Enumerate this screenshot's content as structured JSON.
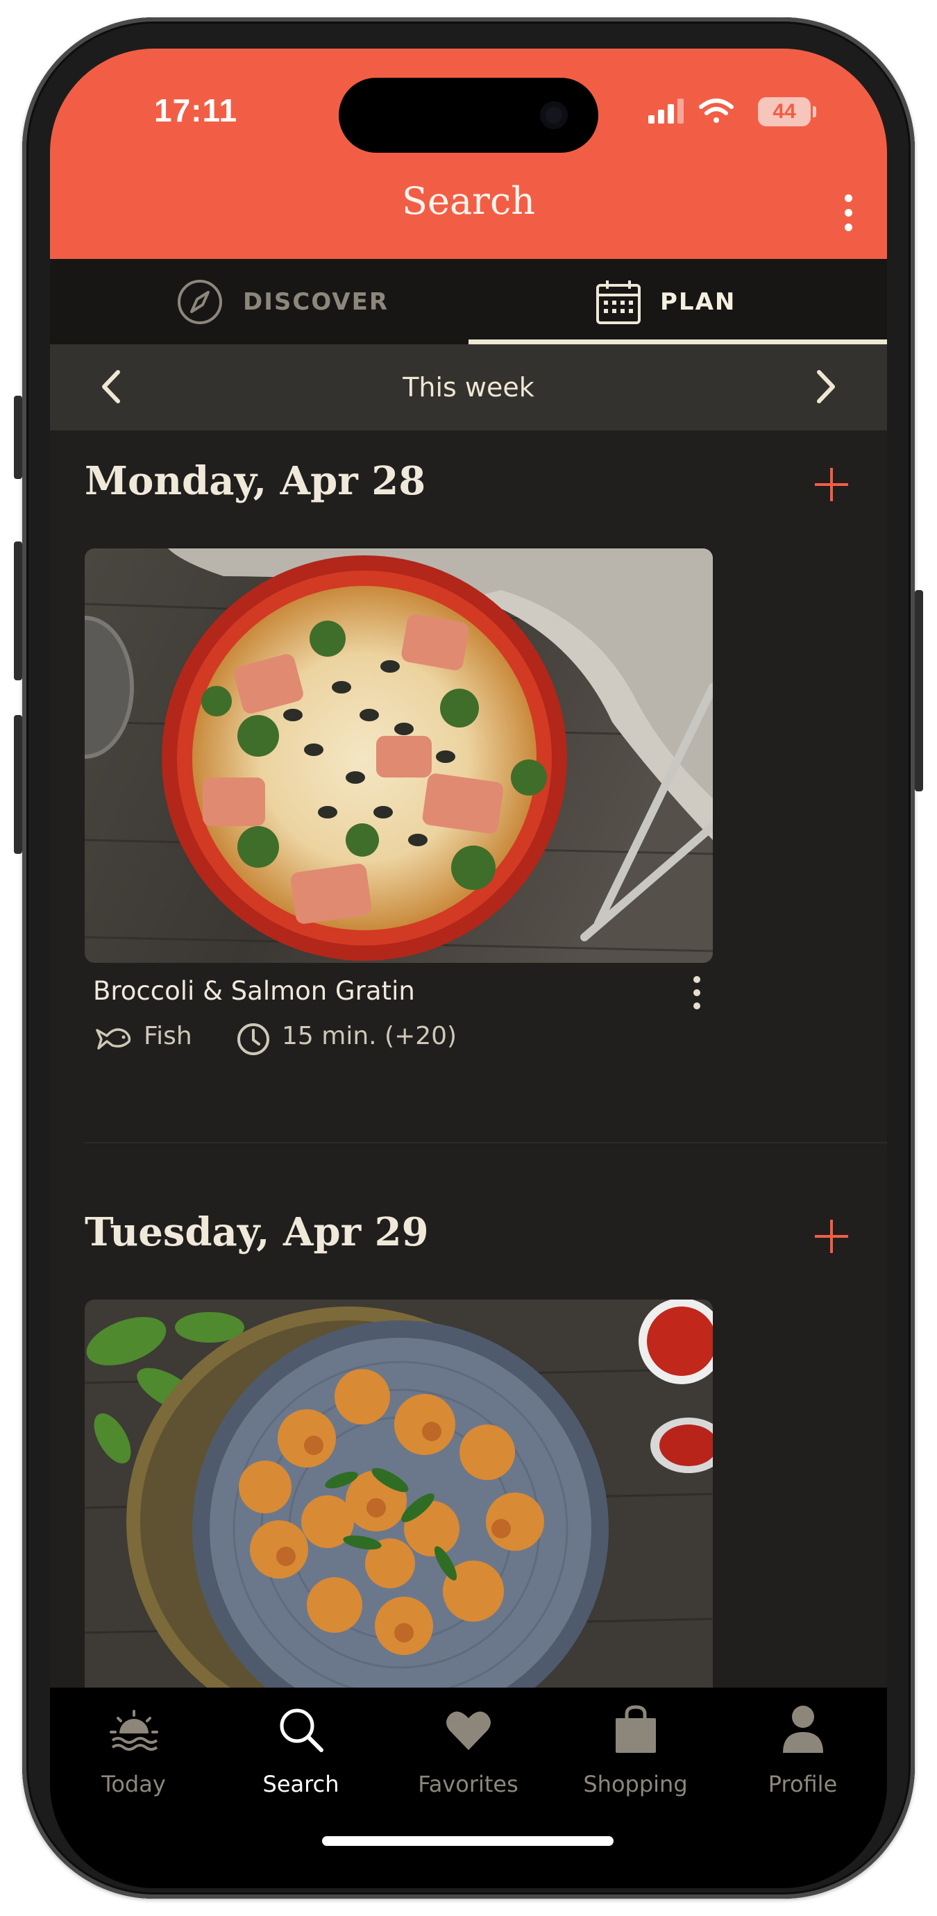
{
  "status_bar": {
    "time": "17:11",
    "battery": "44"
  },
  "header": {
    "title": "Search",
    "accent_color": "#f25e45"
  },
  "tabs": [
    {
      "label": "DISCOVER",
      "icon": "compass-icon",
      "selected": false
    },
    {
      "label": "PLAN",
      "icon": "calendar-icon",
      "selected": true
    }
  ],
  "week_nav": {
    "label": "This week"
  },
  "days": [
    {
      "title": "Monday, Apr 28",
      "recipe": {
        "name": "Broccoli & Salmon Gratin",
        "category": "Fish",
        "time": "15 min. (+20)"
      }
    },
    {
      "title": "Tuesday, Apr 29"
    }
  ],
  "bottom_nav": [
    {
      "label": "Today",
      "icon": "sunrise-icon",
      "active": false
    },
    {
      "label": "Search",
      "icon": "search-icon",
      "active": true
    },
    {
      "label": "Favorites",
      "icon": "heart-icon",
      "active": false
    },
    {
      "label": "Shopping",
      "icon": "shopping-bag-icon",
      "active": false
    },
    {
      "label": "Profile",
      "icon": "person-icon",
      "active": false
    }
  ]
}
